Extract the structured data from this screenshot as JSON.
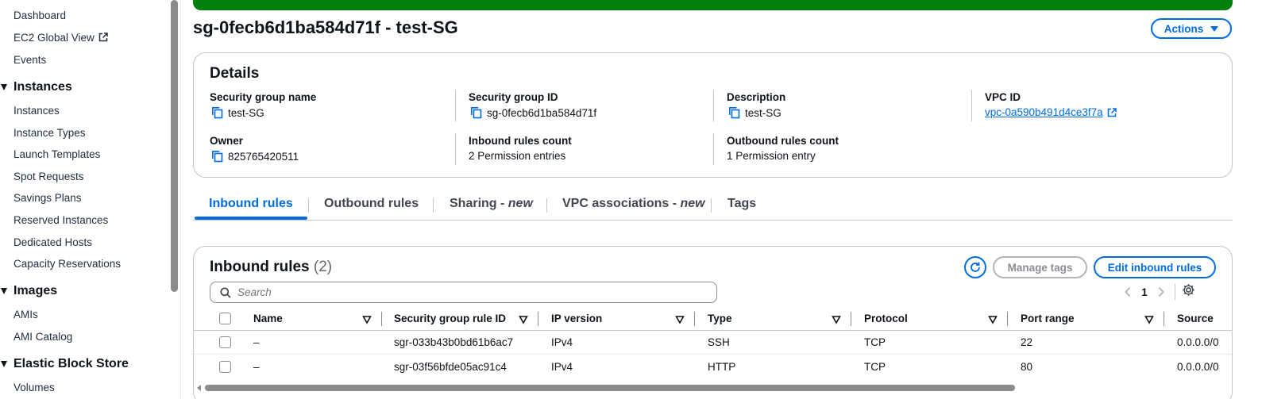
{
  "sidebar": {
    "items_top": [
      "Dashboard",
      "EC2 Global View",
      "Events"
    ],
    "sections": [
      {
        "title": "Instances",
        "items": [
          "Instances",
          "Instance Types",
          "Launch Templates",
          "Spot Requests",
          "Savings Plans",
          "Reserved Instances",
          "Dedicated Hosts",
          "Capacity Reservations"
        ]
      },
      {
        "title": "Images",
        "items": [
          "AMIs",
          "AMI Catalog"
        ]
      },
      {
        "title": "Elastic Block Store",
        "items": [
          "Volumes"
        ]
      }
    ]
  },
  "header": {
    "title": "sg-0fecb6d1ba584d71f - test-SG",
    "actions_label": "Actions"
  },
  "details": {
    "title": "Details",
    "fields": {
      "sg_name": {
        "label": "Security group name",
        "value": "test-SG"
      },
      "sg_id": {
        "label": "Security group ID",
        "value": "sg-0fecb6d1ba584d71f"
      },
      "description": {
        "label": "Description",
        "value": "test-SG"
      },
      "vpc_id": {
        "label": "VPC ID",
        "value": "vpc-0a590b491d4ce3f7a"
      },
      "owner": {
        "label": "Owner",
        "value": "825765420511"
      },
      "inbound_count": {
        "label": "Inbound rules count",
        "value": "2 Permission entries"
      },
      "outbound_count": {
        "label": "Outbound rules count",
        "value": "1 Permission entry"
      }
    }
  },
  "tabs": {
    "inbound": "Inbound rules",
    "outbound": "Outbound rules",
    "sharing": "Sharing - ",
    "sharing_new": "new",
    "vpc_assoc": "VPC associations - ",
    "vpc_assoc_new": "new",
    "tags": "Tags"
  },
  "inbound_rules": {
    "title": "Inbound rules",
    "count": "(2)",
    "manage_tags_label": "Manage tags",
    "edit_label": "Edit inbound rules",
    "search_placeholder": "Search",
    "page": "1",
    "columns": [
      "Name",
      "Security group rule ID",
      "IP version",
      "Type",
      "Protocol",
      "Port range",
      "Source"
    ],
    "rows": [
      [
        "–",
        "sgr-033b43b0bd61b6ac7",
        "IPv4",
        "SSH",
        "TCP",
        "22",
        "0.0.0.0/0"
      ],
      [
        "–",
        "sgr-03f56bfde05ac91c4",
        "IPv4",
        "HTTP",
        "TCP",
        "80",
        "0.0.0.0/0"
      ]
    ]
  },
  "colors": {
    "link_blue": "#006ce0",
    "success_green": "#037f0c",
    "border": "#c6c6cd"
  }
}
